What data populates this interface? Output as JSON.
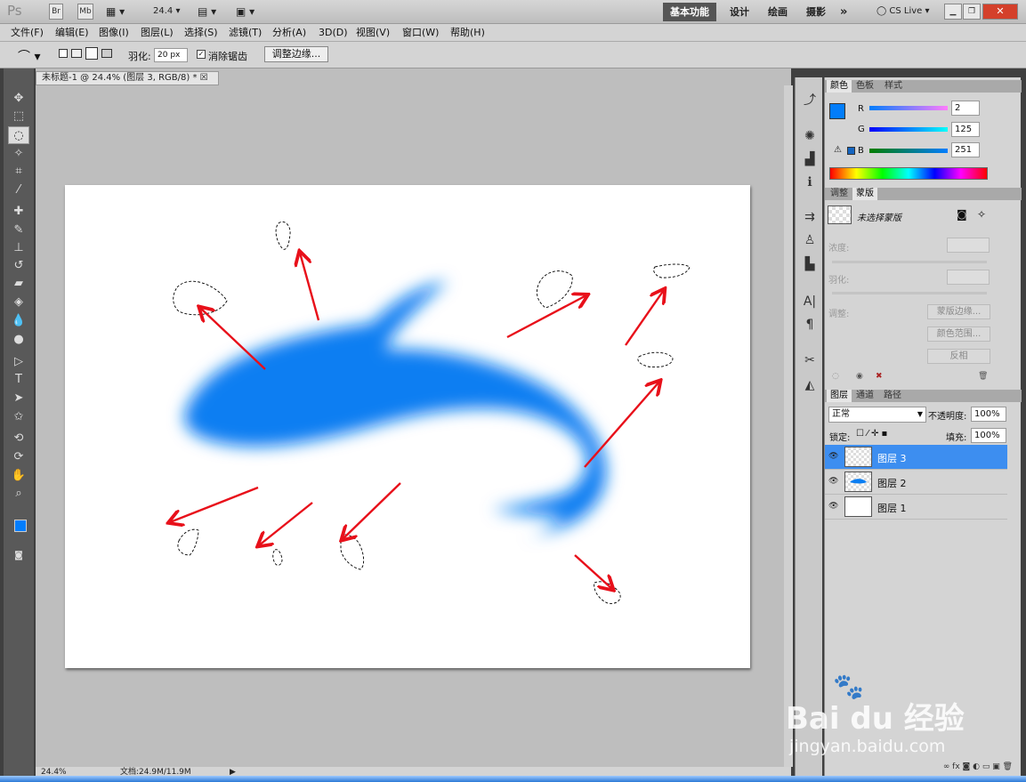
{
  "app": {
    "logo": "Ps",
    "zoom_dropdown": "24.4",
    "bridge": "Br",
    "minibridge": "Mb"
  },
  "workspace": {
    "active": "基本功能",
    "items": [
      "设计",
      "绘画",
      "摄影"
    ],
    "more": "»",
    "cslive": "CS Live"
  },
  "menu": [
    "文件(F)",
    "编辑(E)",
    "图像(I)",
    "图层(L)",
    "选择(S)",
    "滤镜(T)",
    "分析(A)",
    "3D(D)",
    "视图(V)",
    "窗口(W)",
    "帮助(H)"
  ],
  "options": {
    "feather_label": "羽化:",
    "feather_value": "20 px",
    "antialias_label": "消除锯齿",
    "refine_button": "调整边缘..."
  },
  "document": {
    "tab_title": "未标题-1 @ 24.4% (图层 3, RGB/8) *",
    "zoom": "24.4%",
    "doc_info": "文档:24.9M/11.9M"
  },
  "color_panel": {
    "tabs": [
      "颜色",
      "色板",
      "样式"
    ],
    "r_label": "R",
    "g_label": "G",
    "b_label": "B",
    "r": "2",
    "g": "125",
    "b": "251",
    "fg_color": "#027dfb"
  },
  "masks_panel": {
    "tabs": [
      "调整",
      "蒙版"
    ],
    "title": "未选择蒙版",
    "density_label": "浓度:",
    "feather_label": "羽化:",
    "refine_label": "调整:",
    "buttons": [
      "蒙版边缘...",
      "颜色范围...",
      "反相"
    ]
  },
  "layers_panel": {
    "tabs": [
      "图层",
      "通道",
      "路径"
    ],
    "blend_mode": "正常",
    "opacity_label": "不透明度:",
    "opacity": "100%",
    "lock_label": "锁定:",
    "fill_label": "填充:",
    "fill": "100%",
    "layers": [
      {
        "name": "图层 3",
        "selected": true
      },
      {
        "name": "图层 2",
        "selected": false
      },
      {
        "name": "图层 1",
        "selected": false
      }
    ]
  },
  "watermark": {
    "brand": "Bai du 经验",
    "url": "jingyan.baidu.com"
  },
  "colors": {
    "accent": "#027dfb",
    "arrow": "#e8101a",
    "selected_layer": "#3d8ef0"
  }
}
